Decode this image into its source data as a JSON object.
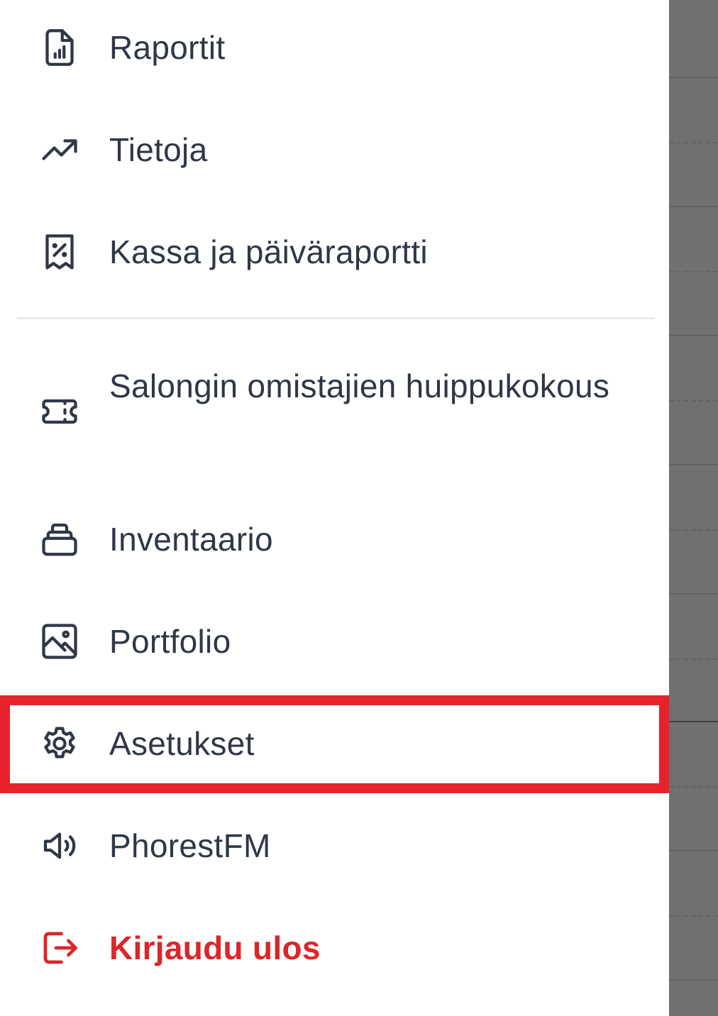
{
  "menu": {
    "items": [
      {
        "id": "reports",
        "label": "Raportit",
        "icon": "report-icon"
      },
      {
        "id": "insights",
        "label": "Tietoja",
        "icon": "trending-up-icon"
      },
      {
        "id": "cash",
        "label": "Kassa ja päiväraportti",
        "icon": "receipt-percent-icon"
      },
      {
        "id": "summit",
        "label": "Salongin omistajien huippukokous",
        "icon": "ticket-icon"
      },
      {
        "id": "inventory",
        "label": "Inventaario",
        "icon": "stack-icon"
      },
      {
        "id": "portfolio",
        "label": "Portfolio",
        "icon": "image-icon"
      },
      {
        "id": "settings",
        "label": "Asetukset",
        "icon": "gear-icon"
      },
      {
        "id": "radio",
        "label": "PhorestFM",
        "icon": "speaker-icon"
      },
      {
        "id": "logout",
        "label": "Kirjaudu ulos",
        "icon": "logout-icon"
      }
    ]
  },
  "colors": {
    "text": "#2f3747",
    "danger": "#dc2627",
    "highlight_border": "#e8222b",
    "divider": "#e7e9ed",
    "overlay": "#6f7072"
  },
  "highlighted_item": "settings"
}
